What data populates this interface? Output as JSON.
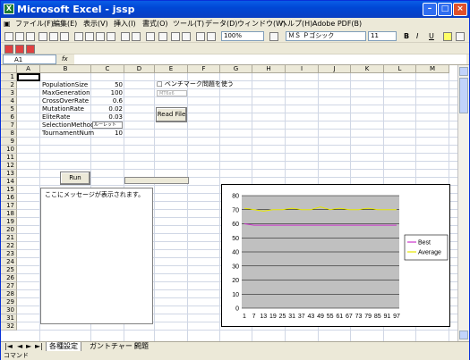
{
  "window": {
    "title": "Microsoft Excel - jssp",
    "app_icon": "X"
  },
  "menu": [
    "ファイル(F)",
    "編集(E)",
    "表示(V)",
    "挿入(I)",
    "書式(O)",
    "ツール(T)",
    "データ(D)",
    "ウィンドウ(W)",
    "ヘルプ(H)",
    "Adobe PDF(B)"
  ],
  "toolbar": {
    "zoom": "100%",
    "font_name": "ＭＳ Ｐゴシック",
    "font_size": "11",
    "bold": "B",
    "italic": "I",
    "underline": "U"
  },
  "formula_bar": {
    "cell_ref": "A1",
    "fx": "fx",
    "value": ""
  },
  "columns": [
    "A",
    "B",
    "C",
    "D",
    "E",
    "F",
    "G",
    "H",
    "I",
    "J",
    "K",
    "L",
    "M"
  ],
  "rows": [
    "1",
    "2",
    "3",
    "4",
    "5",
    "6",
    "7",
    "8",
    "9",
    "10",
    "11",
    "12",
    "13",
    "14",
    "15",
    "16",
    "17",
    "18",
    "19",
    "20",
    "21",
    "22",
    "23",
    "24",
    "25",
    "26",
    "27",
    "28",
    "29",
    "30",
    "31",
    "32"
  ],
  "params": [
    {
      "label": "PopulationSize",
      "value": "50"
    },
    {
      "label": "MaxGeneration",
      "value": "100"
    },
    {
      "label": "CrossOverRate",
      "value": "0.6"
    },
    {
      "label": "MutationRate",
      "value": "0.02"
    },
    {
      "label": "EliteRate",
      "value": "0.03"
    },
    {
      "label": "SelectionMethod",
      "value": "ルーレット"
    },
    {
      "label": "TournamentNum",
      "value": "10"
    }
  ],
  "bench": {
    "checkbox_label": "ベンチマーク問題を使う",
    "dropdown_value": "MT6x6"
  },
  "buttons": {
    "read_file": "Read File",
    "run": "Run"
  },
  "message": "ここにメッセージが表示されます。",
  "sheet_tabs": [
    "各種設定",
    "ガントチャート",
    "問題"
  ],
  "status_text": "コマンド",
  "chart_data": {
    "type": "line",
    "x_ticks": [
      "1",
      "7",
      "13",
      "19",
      "25",
      "31",
      "37",
      "43",
      "49",
      "55",
      "61",
      "67",
      "73",
      "79",
      "85",
      "91",
      "97"
    ],
    "ylim": [
      0,
      80
    ],
    "y_ticks": [
      "0",
      "10",
      "20",
      "30",
      "40",
      "50",
      "60",
      "70",
      "80"
    ],
    "series": [
      {
        "name": "Best",
        "color": "#cc33cc",
        "values": [
          60,
          59,
          59,
          59,
          59,
          59,
          59,
          59,
          59,
          59,
          59,
          59,
          59,
          59,
          59,
          59,
          59
        ]
      },
      {
        "name": "Average",
        "color": "#e6e600",
        "values": [
          71,
          70,
          69,
          70,
          70,
          71,
          70,
          70,
          72,
          70,
          71,
          70,
          70,
          71,
          70,
          70,
          70
        ]
      }
    ]
  }
}
